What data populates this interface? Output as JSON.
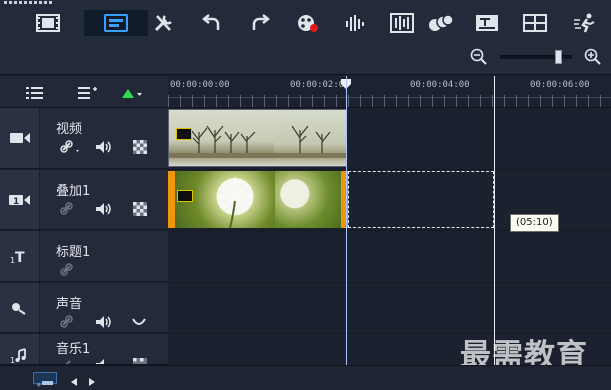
{
  "toolbar": {
    "buttons": [
      {
        "name": "storyboard-view",
        "icon": "filmstrip-icon"
      },
      {
        "name": "timeline-view",
        "icon": "timeline-icon",
        "active": true
      },
      {
        "name": "tools",
        "icon": "tools-icon"
      },
      {
        "name": "undo",
        "icon": "undo-icon"
      },
      {
        "name": "redo",
        "icon": "redo-icon"
      },
      {
        "name": "record-capture",
        "icon": "record-icon"
      },
      {
        "name": "sound-mixer",
        "icon": "sound-mixer-icon"
      },
      {
        "name": "auto-music",
        "icon": "auto-music-icon"
      },
      {
        "name": "motion-tracking",
        "icon": "motion-tracking-icon"
      },
      {
        "name": "subtitle-editor",
        "icon": "subtitle-icon"
      },
      {
        "name": "multi-camera",
        "icon": "multi-camera-icon"
      },
      {
        "name": "time-remapping",
        "icon": "time-remap-icon"
      }
    ],
    "zoom": {
      "level": 0.85
    }
  },
  "panel_controls": {
    "track_manager": "track-manager-icon",
    "chapter_point": "chapter-icon",
    "show_all": "show-all-icon"
  },
  "ruler": {
    "ticks": [
      "00:00:00:00",
      "00:00:02:00",
      "00:00:04:00",
      "00:00:06:00"
    ]
  },
  "tracks": [
    {
      "name": "视频",
      "icon": "video-track-icon"
    },
    {
      "name": "叠加1",
      "icon": "overlay-track-icon"
    },
    {
      "name": "标题1",
      "icon": "title-track-icon"
    },
    {
      "name": "声音",
      "icon": "voice-track-icon"
    },
    {
      "name": "音乐1",
      "icon": "music-track-icon"
    }
  ],
  "tooltip": {
    "text": "(05:10)"
  },
  "watermark": {
    "text": "最需教育"
  },
  "colors": {
    "accent_orange": "#f0960a",
    "badge_yellow": "#d7c500",
    "active_blue": "#0f1a2b"
  }
}
